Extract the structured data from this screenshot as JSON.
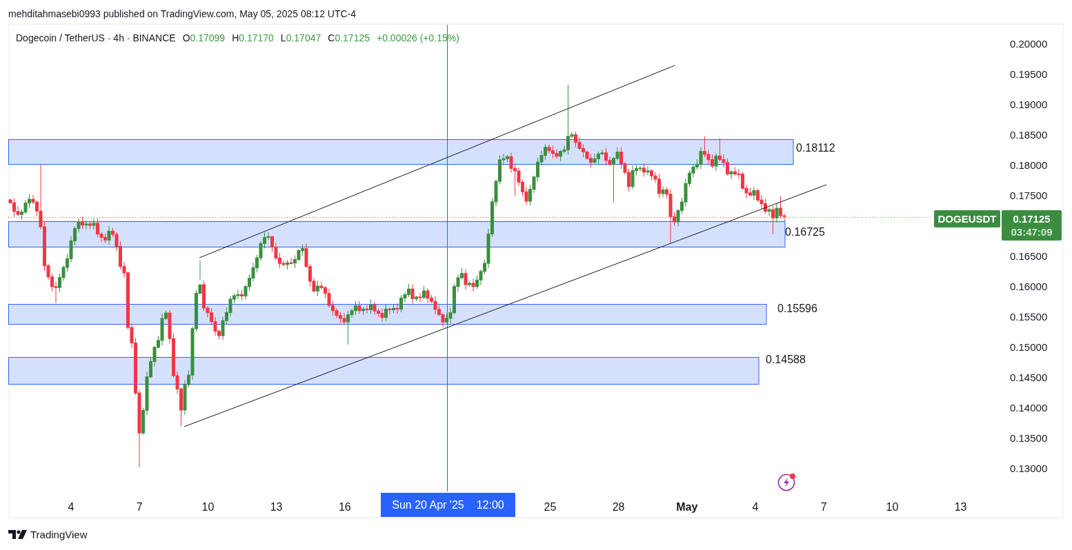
{
  "header": {
    "attribution": "mehditahmasebi0993 published on TradingView.com, May 05, 2025 08:12 UTC-4"
  },
  "legend": {
    "symbol": "Dogecoin / TetherUS · 4h · BINANCE",
    "ohlc": [
      {
        "label": "O",
        "value": "0.17099"
      },
      {
        "label": "H",
        "value": "0.17170"
      },
      {
        "label": "L",
        "value": "0.17047"
      },
      {
        "label": "C",
        "value": "0.17125"
      }
    ],
    "change": "+0.00026 (+0.15%)"
  },
  "price_axis": {
    "labels": [
      "0.20000",
      "0.19500",
      "0.19000",
      "0.18500",
      "0.18000",
      "0.17500",
      "0.16500",
      "0.16000",
      "0.15500",
      "0.15000",
      "0.14500",
      "0.14000",
      "0.13500",
      "0.13000"
    ]
  },
  "zones": [
    {
      "label": "0.18112"
    },
    {
      "label": "0.16725"
    },
    {
      "label": "0.15596"
    },
    {
      "label": "0.14588"
    }
  ],
  "last_price": {
    "symbol": "DOGEUSDT",
    "price": "0.17125",
    "countdown": "03:47:09"
  },
  "crosshair": {
    "date": "Sun 20 Apr '25",
    "time": "12:00"
  },
  "time_axis": {
    "labels": [
      {
        "text": "4",
        "kind": "day"
      },
      {
        "text": "7",
        "kind": "day"
      },
      {
        "text": "10",
        "kind": "day"
      },
      {
        "text": "13",
        "kind": "day"
      },
      {
        "text": "16",
        "kind": "day"
      },
      {
        "text": "25",
        "kind": "day"
      },
      {
        "text": "28",
        "kind": "day"
      },
      {
        "text": "May",
        "kind": "month"
      },
      {
        "text": "4",
        "kind": "day"
      },
      {
        "text": "7",
        "kind": "day"
      },
      {
        "text": "10",
        "kind": "day"
      },
      {
        "text": "13",
        "kind": "day"
      }
    ]
  },
  "footer": {
    "brand": "TradingView"
  }
}
